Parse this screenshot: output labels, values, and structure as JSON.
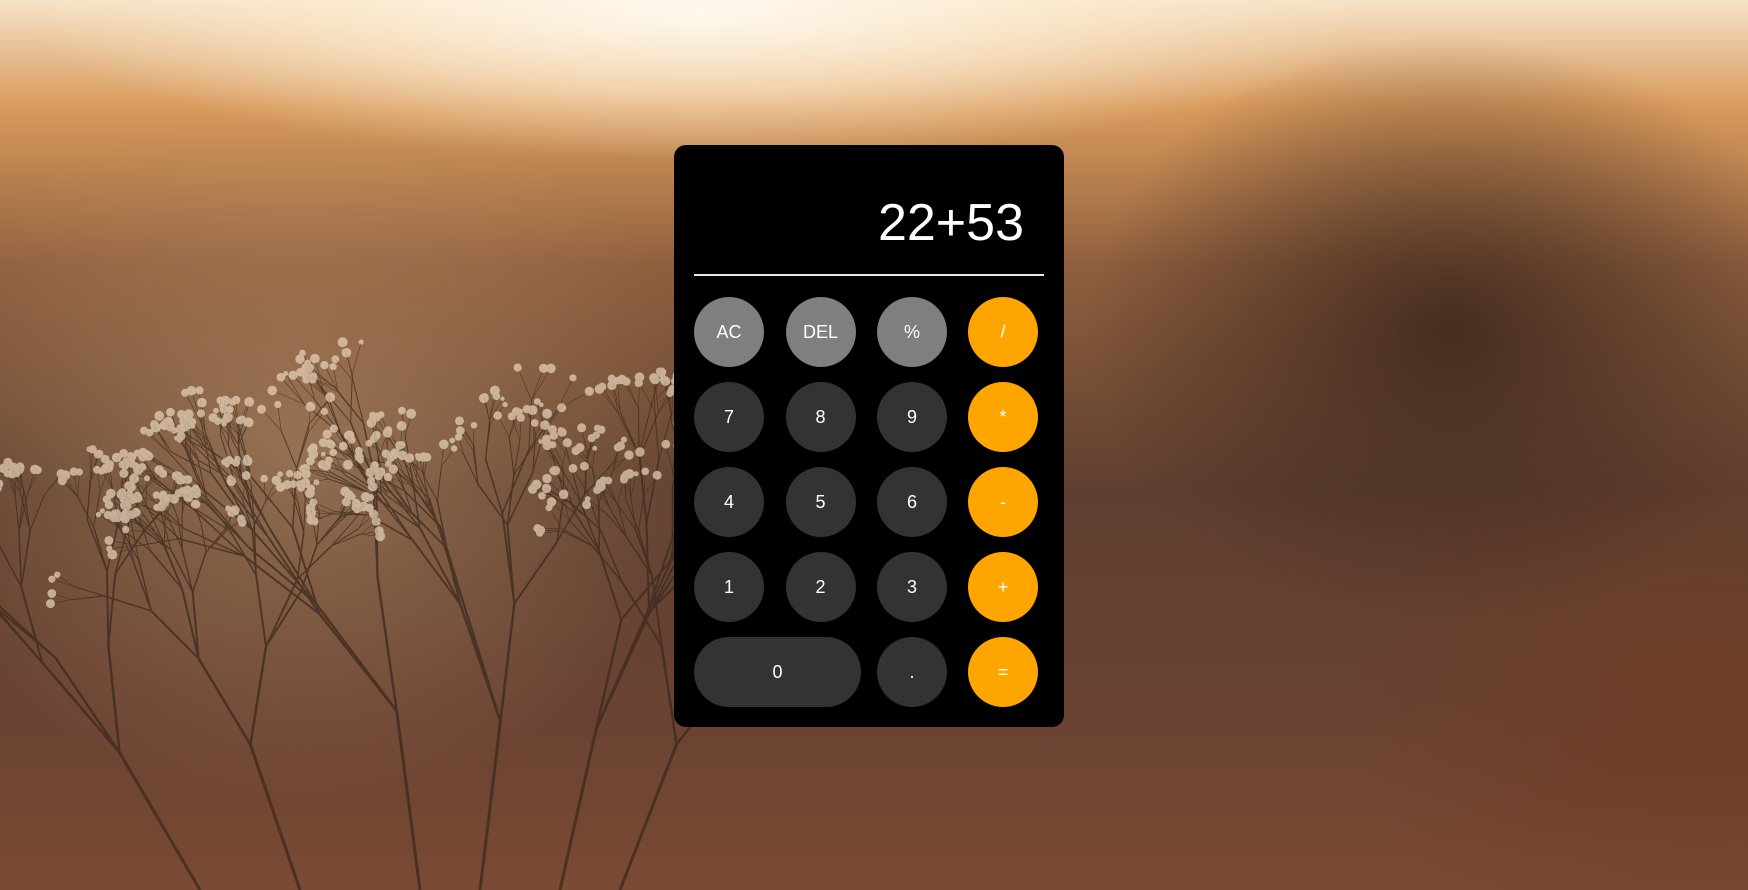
{
  "calculator": {
    "display": "22+53",
    "rows": [
      [
        {
          "label": "AC",
          "kind": "fn",
          "name": "clear-button"
        },
        {
          "label": "DEL",
          "kind": "fn",
          "name": "delete-button"
        },
        {
          "label": "%",
          "kind": "fn",
          "name": "percent-button"
        },
        {
          "label": "/",
          "kind": "op",
          "name": "divide-button"
        }
      ],
      [
        {
          "label": "7",
          "kind": "num",
          "name": "digit-7-button"
        },
        {
          "label": "8",
          "kind": "num",
          "name": "digit-8-button"
        },
        {
          "label": "9",
          "kind": "num",
          "name": "digit-9-button"
        },
        {
          "label": "*",
          "kind": "op",
          "name": "multiply-button"
        }
      ],
      [
        {
          "label": "4",
          "kind": "num",
          "name": "digit-4-button"
        },
        {
          "label": "5",
          "kind": "num",
          "name": "digit-5-button"
        },
        {
          "label": "6",
          "kind": "num",
          "name": "digit-6-button"
        },
        {
          "label": "-",
          "kind": "op",
          "name": "subtract-button"
        }
      ],
      [
        {
          "label": "1",
          "kind": "num",
          "name": "digit-1-button"
        },
        {
          "label": "2",
          "kind": "num",
          "name": "digit-2-button"
        },
        {
          "label": "3",
          "kind": "num",
          "name": "digit-3-button"
        },
        {
          "label": "+",
          "kind": "op",
          "name": "add-button"
        }
      ],
      [
        {
          "label": "0",
          "kind": "num",
          "name": "digit-0-button",
          "wide": true
        },
        {
          "label": ".",
          "kind": "num",
          "name": "decimal-button"
        },
        {
          "label": "=",
          "kind": "op",
          "name": "equals-button"
        }
      ]
    ]
  },
  "colors": {
    "function_key": "#7f7f7f",
    "number_key": "#333333",
    "operator_key": "#ffa500",
    "panel": "#000000",
    "text": "#ffffff"
  }
}
